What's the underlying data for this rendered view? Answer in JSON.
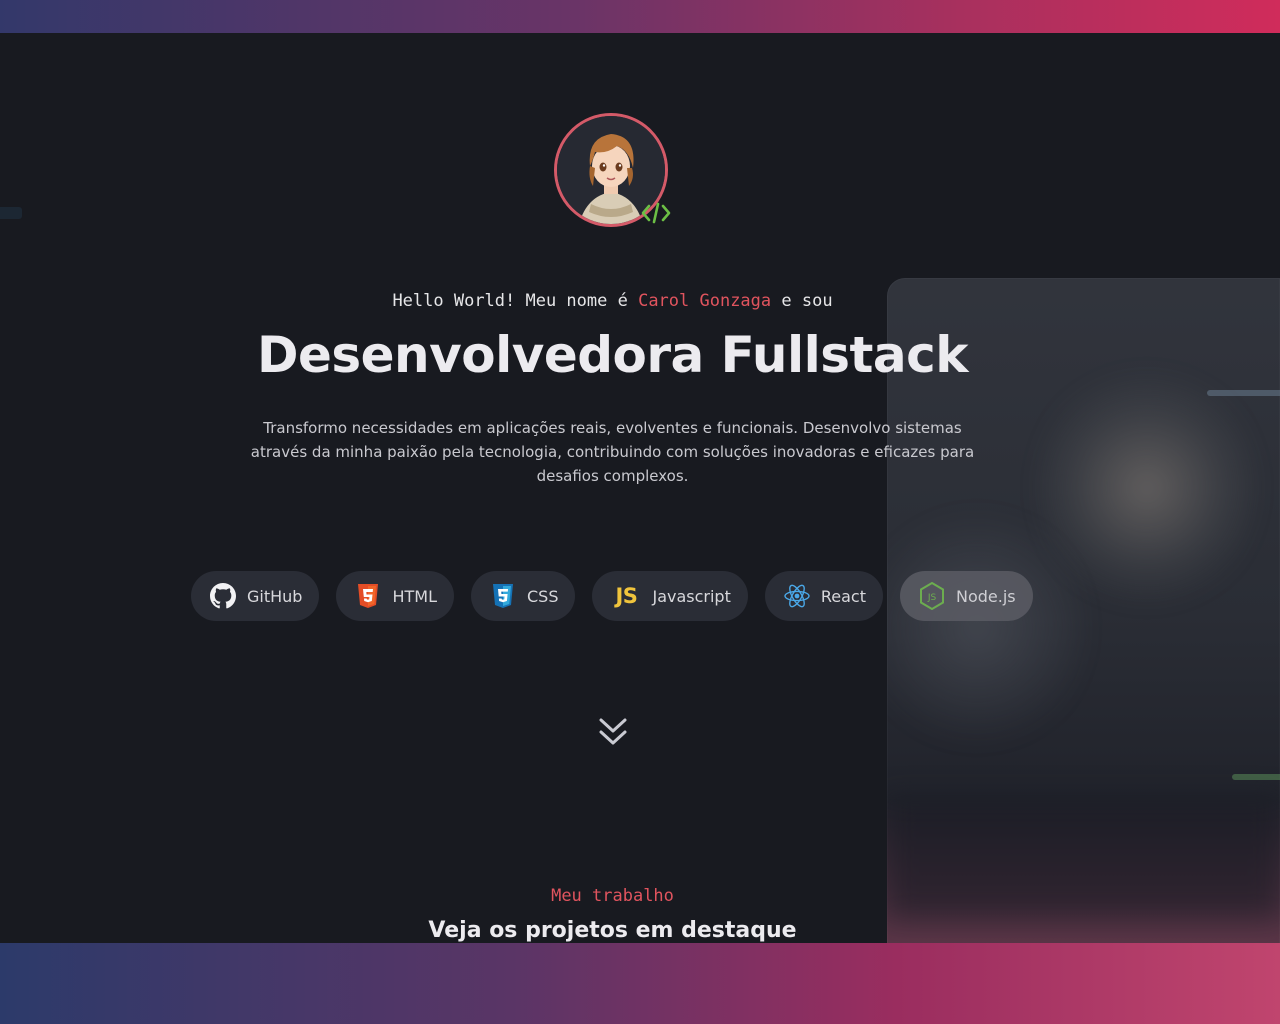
{
  "hero": {
    "greeting_prefix": "Hello World! Meu nome é ",
    "name": "Carol Gonzaga",
    "greeting_suffix": " e sou",
    "headline": "Desenvolvedora Fullstack",
    "description": "Transformo necessidades em aplicações reais, evolventes e funcionais. Desenvolvo sistemas através da minha paixão pela tecnologia, contribuindo com soluções inovadoras e eficazes para desafios complexos."
  },
  "skills": [
    {
      "label": "GitHub",
      "icon": "github-icon"
    },
    {
      "label": "HTML",
      "icon": "html5-icon"
    },
    {
      "label": "CSS",
      "icon": "css3-icon"
    },
    {
      "label": "Javascript",
      "icon": "js-icon"
    },
    {
      "label": "React",
      "icon": "react-icon"
    },
    {
      "label": "Node.js",
      "icon": "nodejs-icon"
    }
  ],
  "scroll_icon": "chevron-double-down-icon",
  "projects_section": {
    "tag": "Meu trabalho",
    "title": "Veja os projetos em destaque"
  },
  "colors": {
    "accent": "#e0545e",
    "background": "#181a20",
    "chip": "#2a2d36",
    "html": "#e44d26",
    "css": "#2f8ddc",
    "js": "#f0c43c",
    "react": "#4aa8e8",
    "node": "#6cad4f"
  }
}
